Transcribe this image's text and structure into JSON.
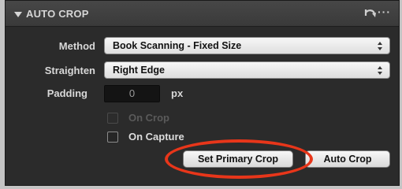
{
  "header": {
    "title": "AUTO CROP"
  },
  "method": {
    "label": "Method",
    "value": "Book Scanning - Fixed Size"
  },
  "straighten": {
    "label": "Straighten",
    "value": "Right Edge"
  },
  "padding": {
    "label": "Padding",
    "value": "0",
    "unit": "px"
  },
  "on_crop": {
    "label": "On Crop",
    "checked": false,
    "enabled": false
  },
  "on_capture": {
    "label": "On Capture",
    "checked": false,
    "enabled": true
  },
  "buttons": {
    "set_primary": "Set Primary Crop",
    "auto_crop": "Auto Crop"
  },
  "colors": {
    "panel_bg": "#2b2b2b",
    "highlight": "#e8361a"
  },
  "icons": {
    "reset": "reset-arrow-icon",
    "more": "more-dots-icon"
  }
}
